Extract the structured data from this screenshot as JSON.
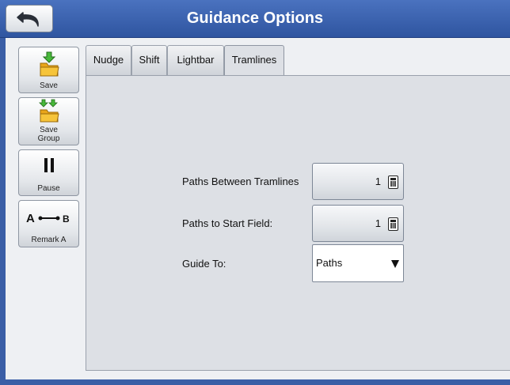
{
  "window": {
    "title": "Guidance Options",
    "accent_color": "#3a5ea6"
  },
  "toolbar": {
    "back_icon": "back-arrow-icon"
  },
  "sidebar": {
    "items": [
      {
        "label": "Save",
        "icon": "save-folder-icon"
      },
      {
        "label": "Save Group",
        "label_line1": "Save",
        "label_line2": "Group",
        "icon": "save-group-folder-icon"
      },
      {
        "label": "Pause",
        "icon": "pause-icon"
      },
      {
        "label": "Remark A",
        "icon": "a-b-line-icon",
        "icon_text_a": "A",
        "icon_text_b": "B"
      }
    ]
  },
  "tabs": [
    {
      "label": "Nudge",
      "active": false
    },
    {
      "label": "Shift",
      "active": false
    },
    {
      "label": "Lightbar",
      "active": false
    },
    {
      "label": "Tramlines",
      "active": true
    }
  ],
  "form": {
    "paths_between_tramlines": {
      "label": "Paths Between Tramlines",
      "value": "1",
      "icon": "calculator-icon"
    },
    "paths_to_start_field": {
      "label": "Paths to Start Field:",
      "value": "1",
      "icon": "calculator-icon"
    },
    "guide_to": {
      "label": "Guide To:",
      "value": "Paths",
      "icon": "dropdown-arrow-icon"
    }
  }
}
